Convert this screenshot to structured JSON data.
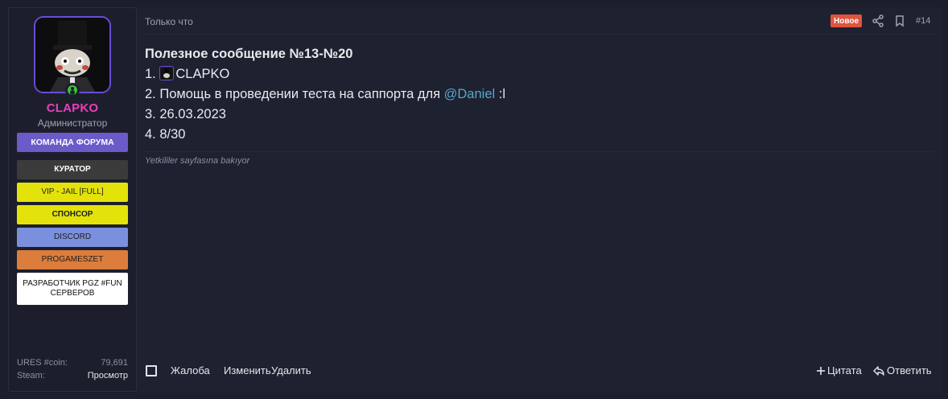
{
  "user": {
    "name": "CLAPKO",
    "title": "Администратор",
    "banners": {
      "team": "КОМАНДА ФОРУМА",
      "curator": "КУРАТОР",
      "vip": "VIP - JAIL [FULL]",
      "sponsor": "СПОНСОР",
      "discord": "DISCORD",
      "pgz": "PROGAMESZET",
      "dev": "РАЗРАБОТЧИК PGZ #FUN СЕРВЕРОВ"
    },
    "stats": [
      {
        "key": "URES #coin:",
        "value": "79,691"
      },
      {
        "key": "Steam:",
        "value": "Просмотр"
      }
    ]
  },
  "post": {
    "time": "Только что",
    "badge": "Новое",
    "number": "#14",
    "title": "Полезное сообщение №13-№20",
    "line1_prefix": "1.",
    "line1_name": "CLAPKO",
    "line2_text": "2. Помощь в проведении теста на саппорта для",
    "line2_mention": "@Daniel",
    "line2_suffix": ":l",
    "line3": "3. 26.03.2023",
    "line4": "4. 8/30",
    "last_edit": "Yetkililer sayfasına bakıyor"
  },
  "actions": {
    "report": "Жалоба",
    "edit": "Изменить",
    "delete": "Удалить",
    "quote": "Цитата",
    "reply": "Ответить"
  },
  "icons": {
    "share": "share-icon",
    "bookmark": "bookmark-icon",
    "quote": "plus-icon",
    "reply": "reply-arrow-icon",
    "online": "online-status-icon"
  },
  "colors": {
    "background": "#1c1f2b",
    "username": "#e93fbf",
    "badge": "#e0533f",
    "mention": "#58a7c8",
    "avatar_border": "#6b4bd6"
  }
}
